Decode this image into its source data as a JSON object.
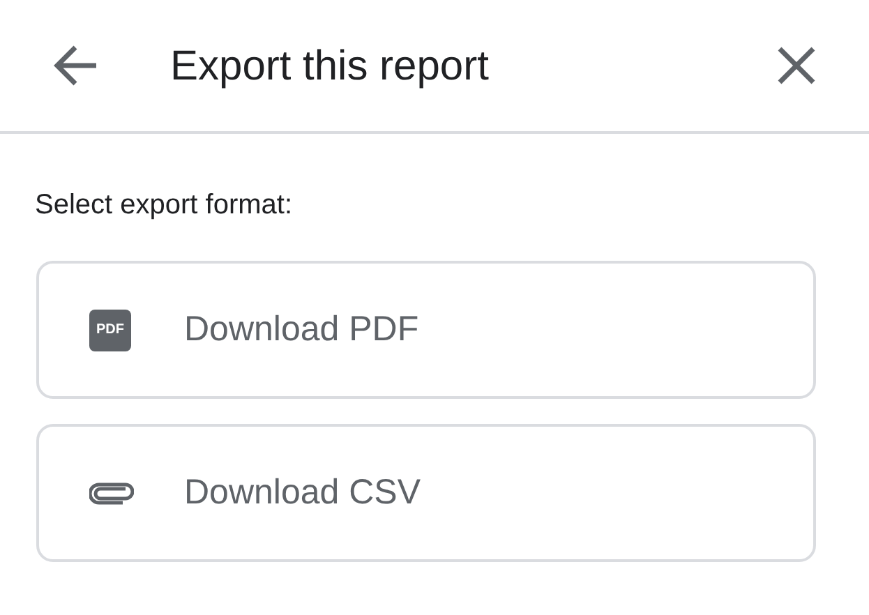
{
  "header": {
    "title": "Export this report"
  },
  "prompt": "Select export format:",
  "options": [
    {
      "kind": "pdf",
      "icon_text": "PDF",
      "label": "Download PDF"
    },
    {
      "kind": "attachment",
      "label": "Download CSV"
    }
  ]
}
